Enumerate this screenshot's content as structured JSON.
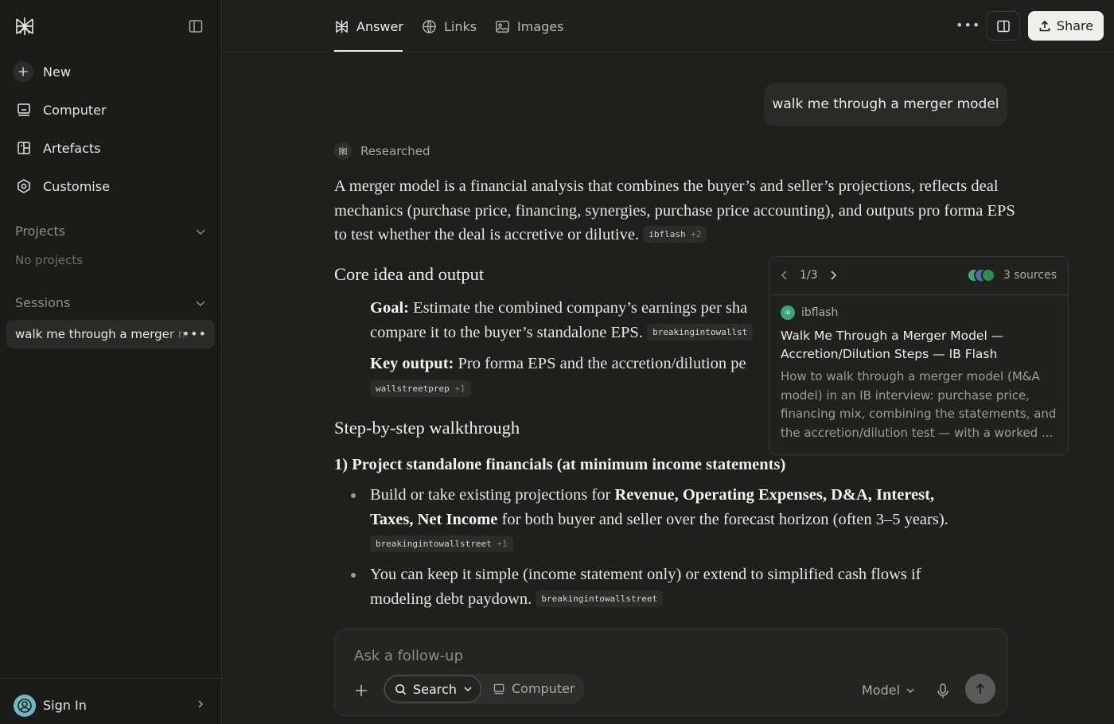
{
  "sidebar": {
    "nav": [
      {
        "label": "New",
        "icon": "plus-icon"
      },
      {
        "label": "Computer",
        "icon": "computer-icon"
      },
      {
        "label": "Artefacts",
        "icon": "artefacts-icon"
      },
      {
        "label": "Customise",
        "icon": "customise-icon"
      }
    ],
    "projects_label": "Projects",
    "no_projects": "No projects",
    "sessions_label": "Sessions",
    "session_item": "walk me through a merger model",
    "signin_label": "Sign In"
  },
  "tabs": [
    {
      "label": "Answer",
      "icon": "perplexity-icon",
      "active": true
    },
    {
      "label": "Links",
      "icon": "globe-icon",
      "active": false
    },
    {
      "label": "Images",
      "icon": "image-icon",
      "active": false
    }
  ],
  "share_label": "Share",
  "user_query": "walk me through a merger model",
  "status_label": "Researched",
  "answer": {
    "intro": "A merger model is a financial analysis that combines the buyer’s and seller’s projections, reflects deal mechanics (purchase price, financing, synergies, purchase price accounting), and outputs pro forma EPS to test whether the deal is accretive or dilutive.",
    "intro_chip": {
      "name": "ibflash",
      "more": "+2"
    },
    "h_core": "Core idea and output",
    "goal_label": "Goal:",
    "goal_text_1": "Estimate the combined company’s earnings per sha",
    "goal_text_2": "compare it to the buyer’s standalone EPS.",
    "goal_chip": "breakingintowallst",
    "key_label": "Key output:",
    "key_text": "Pro forma EPS and the accretion/dilution pe",
    "key_chip": {
      "name": "wallstreetprep",
      "more": "+1"
    },
    "h_steps": "Step-by-step walkthrough",
    "h_step1": "1) Project standalone financials (at minimum income statements)",
    "b1_pre": "Build or take existing projections for",
    "b1_bold1": "Revenue, Operating Expenses, D&A, Interest,",
    "b1_bold2": "Taxes, Net Income",
    "b1_post": "for both buyer and seller over the forecast horizon (often 3–5 years).",
    "b1_chip": {
      "name": "breakingintowallstreet",
      "more": "+1"
    },
    "b2_line1": "You can keep it simple (income statement only) or extend to simplified cash flows if",
    "b2_line2": "modeling debt paydown.",
    "b2_chip": "breakingintowallstreet"
  },
  "popover": {
    "page": "1/3",
    "sources_label": "3 sources",
    "site": "ibflash",
    "title": "Walk Me Through a Merger Model — Accretion/Dilution Steps — IB Flash",
    "description": "How to walk through a merger model (M&A model) in an IB interview: purchase price, financing mix, combining the statements, and the accretion/dilution test — with a worked ..."
  },
  "composer": {
    "placeholder": "Ask a follow-up",
    "search_label": "Search",
    "computer_label": "Computer",
    "model_label": "Model"
  },
  "colors": {
    "background": "#1f1f1e",
    "sidebar": "#1b1b1a",
    "accent_avatar": "#6fb9c2",
    "share_bg": "#efefed"
  }
}
